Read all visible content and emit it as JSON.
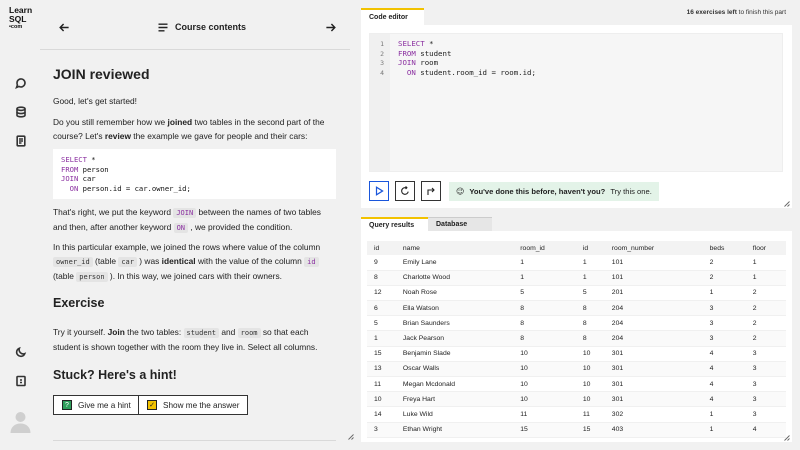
{
  "logo": {
    "line1": "Learn",
    "line2": "SQL",
    "line3": "•com"
  },
  "sidebar": {
    "icons": [
      "chat-icon",
      "database-icon",
      "document-icon",
      "moon-icon",
      "keyboard-icon",
      "avatar"
    ]
  },
  "header": {
    "course_contents": "Course contents"
  },
  "lesson": {
    "title": "JOIN reviewed",
    "p1": "Good, let's get started!",
    "p2a": "Do you still remember how we ",
    "p2b": "joined",
    "p2c": " two tables in the second part of the course? Let's ",
    "p2d": "review",
    "p2e": " the example we gave for people and their cars:",
    "code_sample": [
      {
        "kw": "SELECT",
        "rest": " *"
      },
      {
        "kw": "FROM",
        "rest": " person"
      },
      {
        "kw": "JOIN",
        "rest": " car"
      },
      {
        "kw": "  ON",
        "rest": " person.id = car.owner_id;"
      }
    ],
    "p3a": "That's right, we put the keyword ",
    "p3_kw1": "JOIN",
    "p3b": " between the names of two tables and then, after another keyword ",
    "p3_kw2": "ON",
    "p3c": " , we provided the condition.",
    "p4a": "In this particular example, we joined the rows where value of the column ",
    "p4_col1": "owner_id",
    "p4b": " (table ",
    "p4_tbl1": "car",
    "p4c": " ) was ",
    "p4d": "identical",
    "p4e": " with the value of the column ",
    "p4_col2": "id",
    "p4f": " (table ",
    "p4_tbl2": "person",
    "p4g": " ). In this way, we joined cars with their owners.",
    "exercise_title": "Exercise",
    "p5a": "Try it yourself. ",
    "p5b": "Join",
    "p5c": " the two tables: ",
    "p5_t1": "student",
    "p5d": " and ",
    "p5_t2": "room",
    "p5e": " so that each student is shown together with the room they live in. Select all columns.",
    "hint_title": "Stuck? Here's a hint!",
    "give_hint": "Give me a hint",
    "show_answer": "Show me the answer"
  },
  "editor": {
    "tab_label": "Code editor",
    "exercises_left_count": "16 exercises left",
    "exercises_left_suffix": " to finish this part",
    "line_numbers": [
      "1",
      "2",
      "3",
      "4"
    ],
    "code": [
      {
        "kw": "SELECT",
        "rest": " *"
      },
      {
        "kw": "FROM",
        "rest": " student"
      },
      {
        "kw": "JOIN",
        "rest": " room"
      },
      {
        "kw": "  ON",
        "rest": " student.room_id = room.id;"
      }
    ],
    "banner_bold": "You've done this before, haven't you?",
    "banner_rest": " Try this one."
  },
  "results": {
    "tab_results": "Query results",
    "tab_database": "Database",
    "columns": [
      "id",
      "name",
      "room_id",
      "id",
      "room_number",
      "beds",
      "floor"
    ],
    "rows": [
      [
        "9",
        "Emily Lane",
        "1",
        "1",
        "101",
        "2",
        "1"
      ],
      [
        "8",
        "Charlotte Wood",
        "1",
        "1",
        "101",
        "2",
        "1"
      ],
      [
        "12",
        "Noah Rose",
        "5",
        "5",
        "201",
        "1",
        "2"
      ],
      [
        "6",
        "Ella Watson",
        "8",
        "8",
        "204",
        "3",
        "2"
      ],
      [
        "5",
        "Brian Saunders",
        "8",
        "8",
        "204",
        "3",
        "2"
      ],
      [
        "1",
        "Jack Pearson",
        "8",
        "8",
        "204",
        "3",
        "2"
      ],
      [
        "15",
        "Benjamin Slade",
        "10",
        "10",
        "301",
        "4",
        "3"
      ],
      [
        "13",
        "Oscar Walls",
        "10",
        "10",
        "301",
        "4",
        "3"
      ],
      [
        "11",
        "Megan Mcdonald",
        "10",
        "10",
        "301",
        "4",
        "3"
      ],
      [
        "10",
        "Freya Hart",
        "10",
        "10",
        "301",
        "4",
        "3"
      ],
      [
        "14",
        "Luke Wild",
        "11",
        "11",
        "302",
        "1",
        "3"
      ],
      [
        "3",
        "Ethan Wright",
        "15",
        "15",
        "403",
        "1",
        "4"
      ]
    ]
  },
  "colors": {
    "accent_yellow": "#f2c200",
    "run_blue": "#1a56db",
    "keyword_purple": "#8a2fa0",
    "banner_green": "#e3f3e8"
  }
}
